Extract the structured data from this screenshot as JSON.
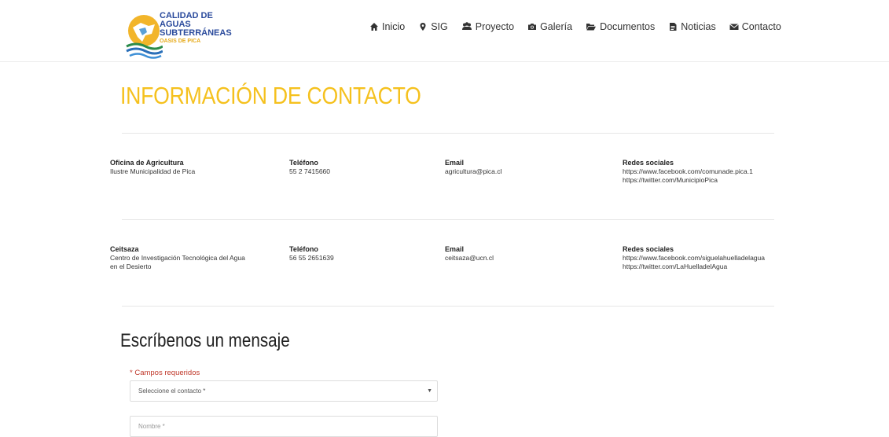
{
  "logo": {
    "line1": "CALIDAD DE AGUAS",
    "line2": "SUBTERRÁNEAS",
    "line3": "OASIS DE PICA"
  },
  "nav": [
    {
      "label": "Inicio",
      "icon": "home-icon"
    },
    {
      "label": "SIG",
      "icon": "map-marker-icon"
    },
    {
      "label": "Proyecto",
      "icon": "users-icon"
    },
    {
      "label": "Galería",
      "icon": "camera-icon"
    },
    {
      "label": "Documentos",
      "icon": "folder-icon"
    },
    {
      "label": "Noticias",
      "icon": "newspaper-icon"
    },
    {
      "label": "Contacto",
      "icon": "envelope-icon"
    }
  ],
  "page_title": "INFORMACIÓN DE CONTACTO",
  "contacts": [
    {
      "org_label": "Oficina de Agricultura",
      "org_value": "Ilustre Municipalidad de Pica",
      "org_value2": "",
      "phone_label": "Teléfono",
      "phone": "55 2 7415660",
      "email_label": "Email",
      "email": "agricultura@pica.cl",
      "social_label": "Redes sociales",
      "social1": "https://www.facebook.com/comunade.pica.1",
      "social2": "https://twitter.com/MunicipioPica"
    },
    {
      "org_label": "Ceitsaza",
      "org_value": "Centro de Investigación Tecnológica del Agua",
      "org_value2": "en el Desierto",
      "phone_label": "Teléfono",
      "phone": "56 55 2651639",
      "email_label": "Email",
      "email": "ceitsaza@ucn.cl",
      "social_label": "Redes sociales",
      "social1": "https://www.facebook.com/siguelahuelladelagua",
      "social2": "https://twitter.com/LaHuelladelAgua"
    }
  ],
  "form": {
    "title": "Escríbenos un mensaje",
    "required_note": "* Campos requeridos",
    "contact_select": "Seleccione el contacto *",
    "name_placeholder": "Nombre *"
  },
  "colors": {
    "accent": "#f5c11e",
    "logo_blue": "#2a4a9c",
    "required_red": "#c0392b"
  }
}
